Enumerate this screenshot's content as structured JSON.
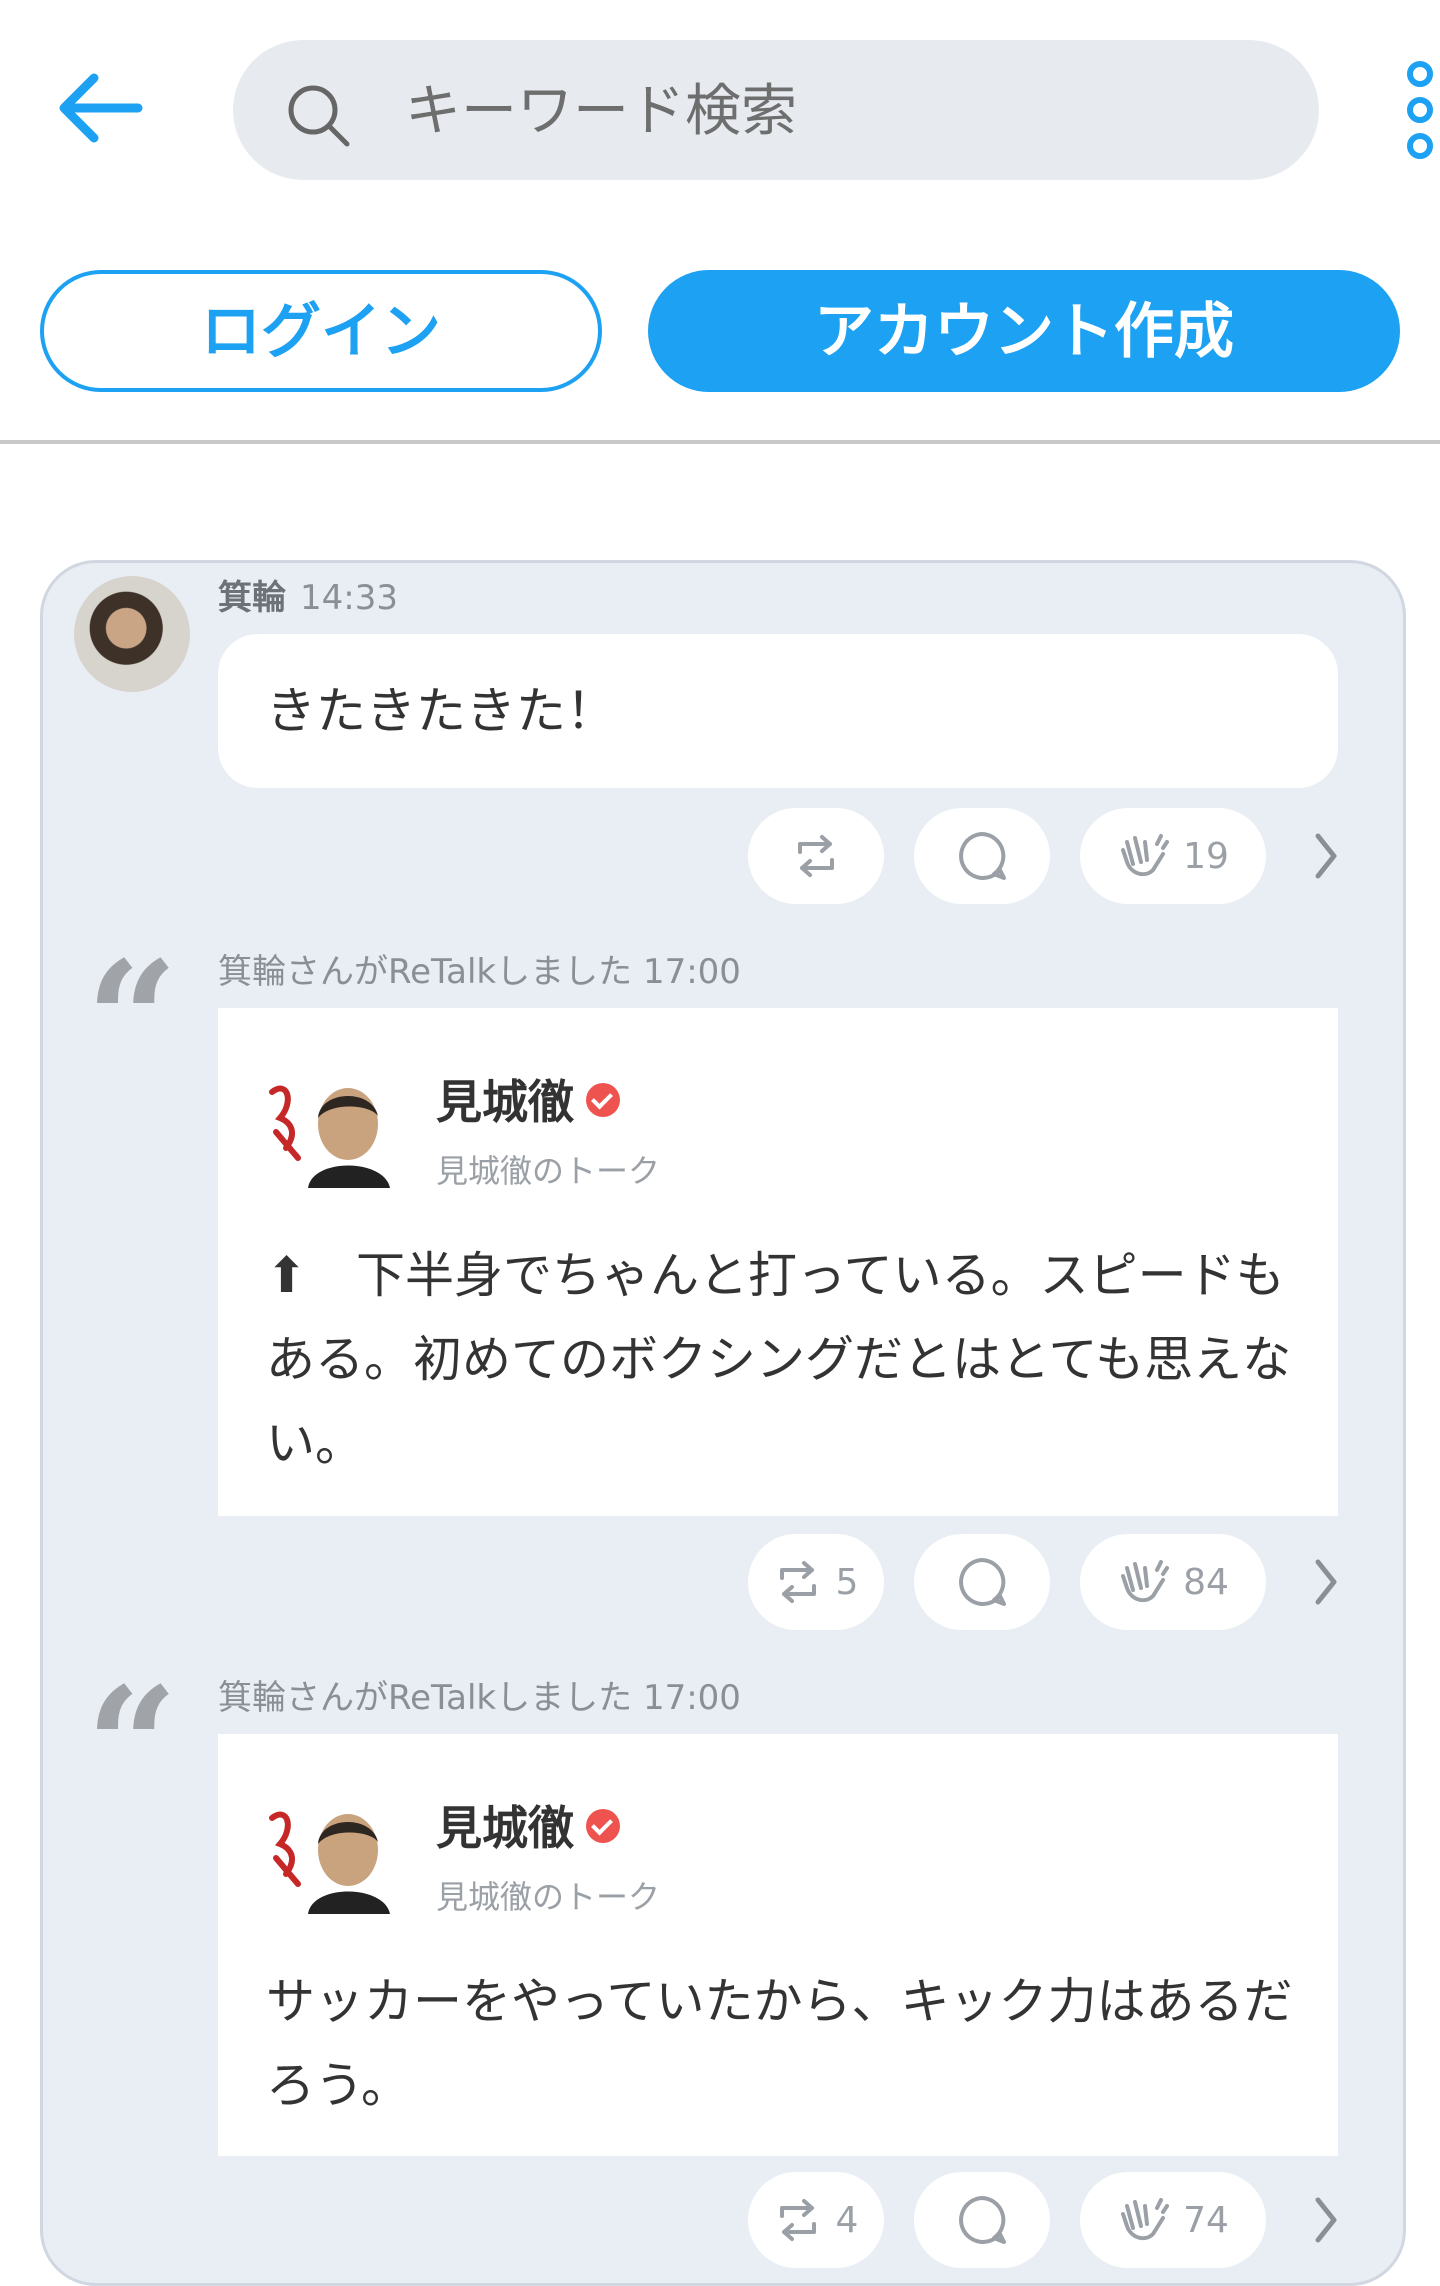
{
  "search": {
    "placeholder": "キーワード検索"
  },
  "auth": {
    "login_label": "ログイン",
    "signup_label": "アカウント作成"
  },
  "colors": {
    "accent": "#1da1f2",
    "feed_bg": "#e9eef4",
    "verified": "#ef5350"
  },
  "feed": {
    "post": {
      "author": "箕輪",
      "time": "14:33",
      "text": "きたきたきた！",
      "retalks": "",
      "claps": "19"
    },
    "retalks": [
      {
        "header": "箕輪さんがReTalkしました",
        "time": "17:00",
        "author": "見城徹",
        "subname": "見城徹のトーク",
        "text": "⬆　下半身でちゃんと打っている。スピードもある。初めてのボクシングだとはとても思えない。",
        "retalks": "5",
        "claps": "84"
      },
      {
        "header": "箕輪さんがReTalkしました",
        "time": "17:00",
        "author": "見城徹",
        "subname": "見城徹のトーク",
        "text": "サッカーをやっていたから、キック力はあるだろう。",
        "retalks": "4",
        "claps": "74"
      }
    ]
  },
  "icons": {
    "back": "arrow-left-icon",
    "search": "search-icon",
    "more": "more-vertical-icon",
    "retalk": "retalk-icon",
    "comment": "comment-icon",
    "clap": "clap-icon",
    "chevron": "chevron-right-icon",
    "quote": "quote-icon"
  }
}
